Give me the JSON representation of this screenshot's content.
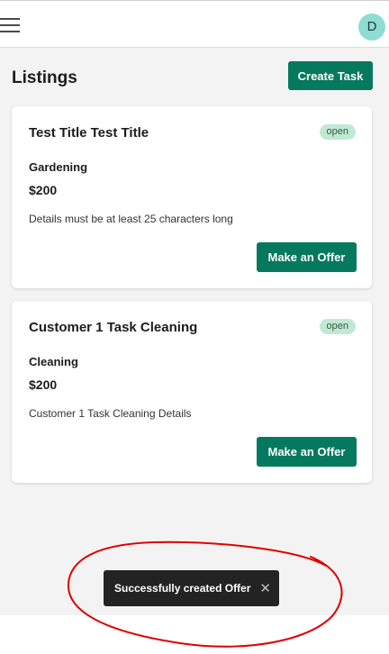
{
  "header": {
    "menu_icon": "hamburger-menu-icon",
    "avatar_initial": "D"
  },
  "page": {
    "title": "Listings",
    "create_task_label": "Create Task"
  },
  "listings": [
    {
      "title": "Test Title Test Title",
      "status": "open",
      "category": "Gardening",
      "price": "$200",
      "details": "Details must be at least 25 characters long",
      "offer_label": "Make an Offer"
    },
    {
      "title": "Customer 1 Task Cleaning",
      "status": "open",
      "category": "Cleaning",
      "price": "$200",
      "details": "Customer 1 Task Cleaning Details",
      "offer_label": "Make an Offer"
    }
  ],
  "toast": {
    "message": "Successfully created Offer",
    "close_icon": "close-icon"
  },
  "colors": {
    "accent": "#05795e",
    "badge_bg": "#bfe9d3",
    "avatar_bg": "#8fdcd2",
    "annotation": "#e00000"
  }
}
